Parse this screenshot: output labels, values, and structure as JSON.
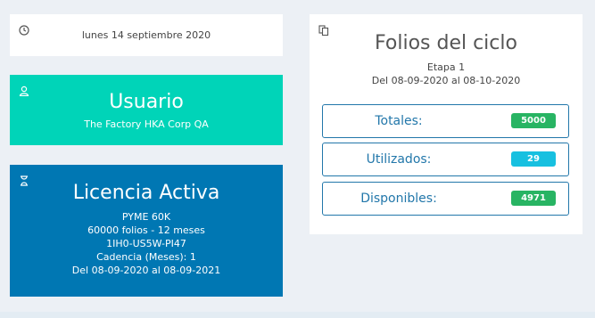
{
  "date_card": {
    "icon": "clock-icon",
    "date": "lunes 14 septiembre 2020"
  },
  "user_card": {
    "icon": "user-icon",
    "title": "Usuario",
    "company": "The Factory HKA Corp QA",
    "color": "#00d4b8"
  },
  "license_card": {
    "icon": "hourglass-icon",
    "title": "Licencia Activa",
    "plan": "PYME 60K",
    "folios": "60000 folios - 12 meses",
    "code": "1IH0-US5W-PI47",
    "cadence": "Cadencia (Meses): 1",
    "period": "Del 08-09-2020 al 08-09-2021",
    "color": "#0077b3"
  },
  "folios_card": {
    "icon": "copy-icon",
    "title": "Folios del ciclo",
    "stage": "Etapa 1",
    "period": "Del 08-09-2020 al 08-10-2020",
    "stats": [
      {
        "label": "Totales:",
        "value": "5000",
        "color": "#28b463"
      },
      {
        "label": "Utilizados:",
        "value": "29",
        "color": "#17c0e0"
      },
      {
        "label": "Disponibles:",
        "value": "4971",
        "color": "#28b463"
      }
    ]
  }
}
